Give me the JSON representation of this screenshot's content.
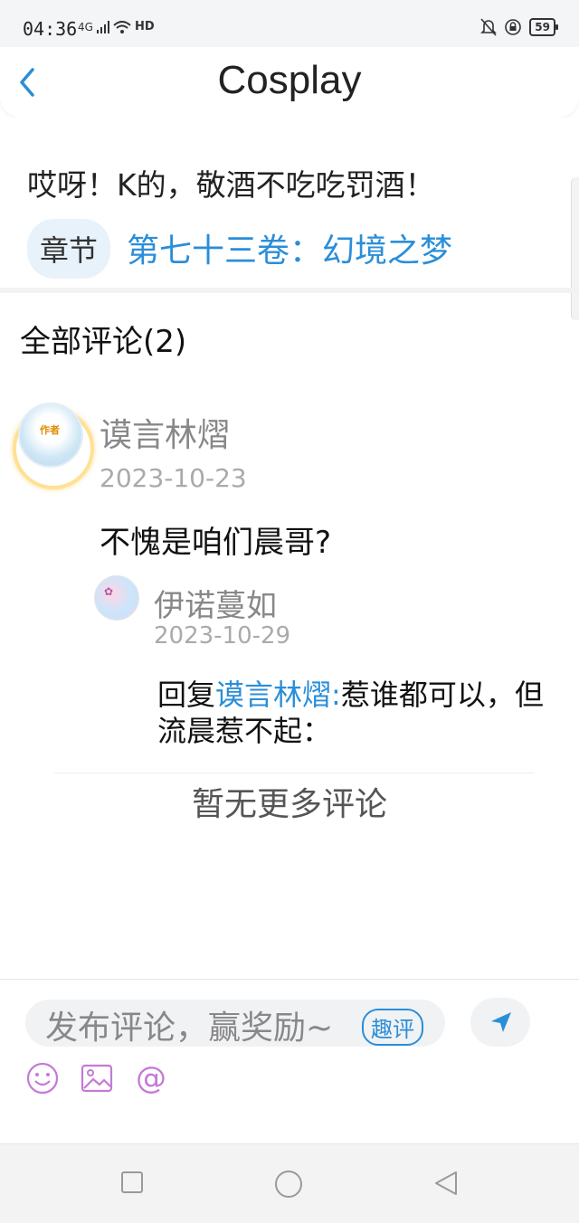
{
  "status_bar": {
    "time": "04:36",
    "network": "4G",
    "hd": "HD",
    "battery": "59"
  },
  "header": {
    "back_label": "‹",
    "title": "Cosplay"
  },
  "chapter": {
    "title": "哎呀！K的，敬酒不吃吃罚酒！",
    "chip_label": "章节",
    "link_text": "第七十三卷：幻境之梦"
  },
  "comments": {
    "heading": "全部评论(2)",
    "items": [
      {
        "author": "谟言林熠",
        "date": "2023-10-23",
        "text": "不愧是咱们晨哥?",
        "avatar_badge": "作者",
        "replies": [
          {
            "author": "伊诺蔓如",
            "date": "2023-10-29",
            "reply_prefix": "回复",
            "mention": "谟言林熠:",
            "text": "惹谁都可以，但流晨惹不起："
          }
        ]
      }
    ],
    "no_more": "暂无更多评论"
  },
  "input": {
    "placeholder": "发布评论，赢奖励~",
    "badge": "趣评",
    "tools": [
      "emoji-icon",
      "image-icon",
      "at-icon"
    ]
  },
  "nav": [
    "square-icon",
    "circle-icon",
    "back-triangle-icon"
  ],
  "colors": {
    "accent": "#2a8ed8",
    "tool_purple": "#c57ad6"
  }
}
